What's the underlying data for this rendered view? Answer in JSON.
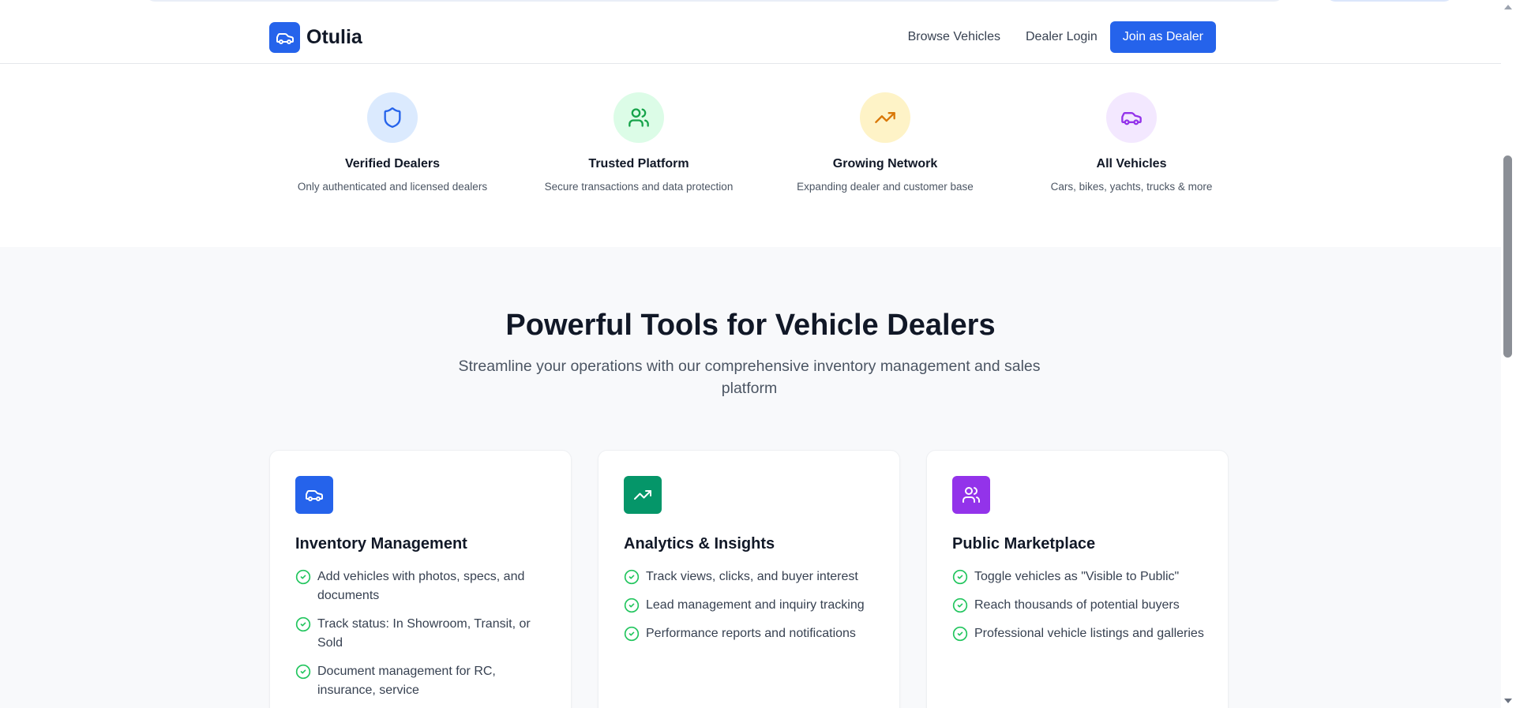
{
  "header": {
    "brand": "Otulia",
    "nav": {
      "browse": "Browse Vehicles",
      "login": "Dealer Login",
      "join": "Join as Dealer"
    }
  },
  "badges": [
    {
      "title": "Verified Dealers",
      "desc": "Only authenticated and licensed dealers",
      "icon": "shield-icon",
      "color": "#2563eb",
      "bg": "#dbeafe"
    },
    {
      "title": "Trusted Platform",
      "desc": "Secure transactions and data protection",
      "icon": "users-icon",
      "color": "#16a34a",
      "bg": "#dcfce7"
    },
    {
      "title": "Growing Network",
      "desc": "Expanding dealer and customer base",
      "icon": "trending-up-icon",
      "color": "#d97706",
      "bg": "#fef3c7"
    },
    {
      "title": "All Vehicles",
      "desc": "Cars, bikes, yachts, trucks & more",
      "icon": "car-icon",
      "color": "#9333ea",
      "bg": "#f3e8ff"
    }
  ],
  "tools": {
    "title": "Powerful Tools for Vehicle Dealers",
    "subtitle": "Streamline your operations with our comprehensive inventory management and sales platform",
    "cards": [
      {
        "title": "Inventory Management",
        "icon": "car-icon",
        "color": "#2563eb",
        "items": [
          "Add vehicles with photos, specs, and documents",
          "Track status: In Showroom, Transit, or Sold",
          "Document management for RC, insurance, service"
        ]
      },
      {
        "title": "Analytics & Insights",
        "icon": "trending-up-icon",
        "color": "#059669",
        "items": [
          "Track views, clicks, and buyer interest",
          "Lead management and inquiry tracking",
          "Performance reports and notifications"
        ]
      },
      {
        "title": "Public Marketplace",
        "icon": "users-icon",
        "color": "#9333ea",
        "items": [
          "Toggle vehicles as \"Visible to Public\"",
          "Reach thousands of potential buyers",
          "Professional vehicle listings and galleries"
        ]
      }
    ]
  }
}
